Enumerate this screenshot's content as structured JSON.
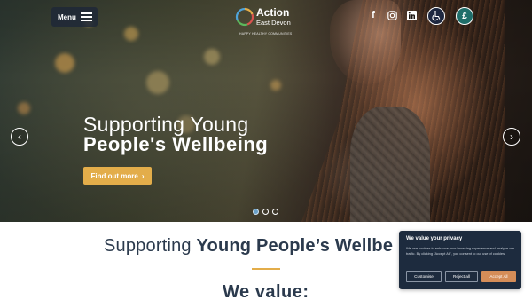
{
  "header": {
    "menu_label": "Menu",
    "logo": {
      "name_line1": "Action",
      "name_line2": "East Devon",
      "tagline": "HAPPY HEALTHY COMMUNITIES"
    },
    "social_icons": [
      "facebook-icon",
      "instagram-icon",
      "linkedin-icon"
    ],
    "accessibility_icon": "wheelchair-icon",
    "donate_symbol": "£"
  },
  "hero": {
    "headline_line1": "Supporting Young",
    "headline_line2": "People's Wellbeing",
    "cta_label": "Find out more",
    "cta_arrow": "›",
    "prev_arrow": "‹",
    "next_arrow": "›",
    "slides_total": 3,
    "active_slide": 1,
    "colors": {
      "cta": "#e3ad4a",
      "active_dot": "#6aa0c8"
    }
  },
  "section": {
    "title_light": "Supporting ",
    "title_bold": "Young People’s Wellbe",
    "subheading": "We value:",
    "rule_color": "#e3ad4a",
    "text_color": "#2b3a4d"
  },
  "cookie_banner": {
    "title": "We value your privacy",
    "body": "We use cookies to enhance your browsing experience and analyse our traffic. By clicking \"Accept All\", you consent to our use of cookies.",
    "customise_label": "Customise",
    "reject_label": "Reject all",
    "accept_label": "Accept All",
    "colors": {
      "background": "#1d2b3e",
      "accept": "#d58d58"
    }
  }
}
